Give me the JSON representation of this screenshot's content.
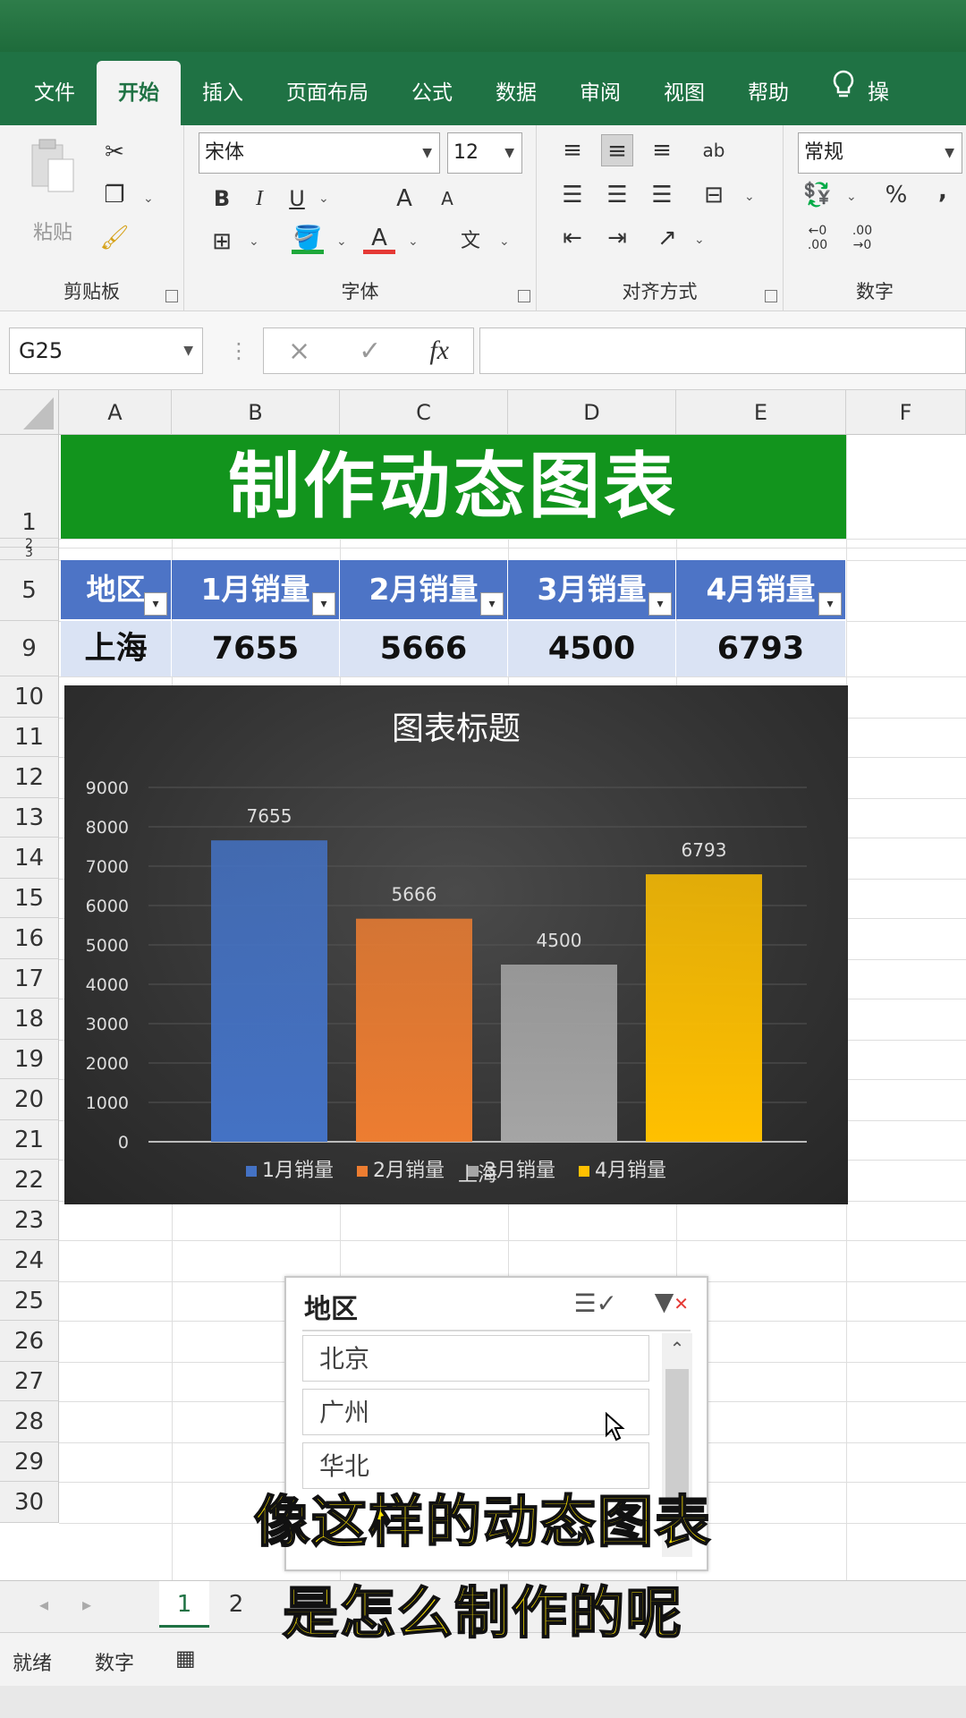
{
  "ribbon_tabs": [
    "文件",
    "开始",
    "插入",
    "页面布局",
    "公式",
    "数据",
    "审阅",
    "视图",
    "帮助"
  ],
  "active_tab": "开始",
  "tell_me": "操",
  "ribbon": {
    "clipboard": {
      "label": "剪贴板",
      "paste": "粘贴"
    },
    "font": {
      "label": "字体",
      "name": "宋体",
      "size": "12",
      "bold": "B",
      "italic": "I",
      "underline": "U",
      "grow": "A",
      "shrink": "A",
      "font_color": "A",
      "phonetic": "文"
    },
    "alignment": {
      "label": "对齐方式",
      "wrap_text": "ab"
    },
    "number": {
      "label": "数字",
      "format": "常规",
      "percent": "%",
      "comma": ","
    }
  },
  "formula_bar": {
    "name_box": "G25",
    "cancel": "×",
    "enter": "✓",
    "fx": "fx",
    "formula": ""
  },
  "columns": [
    "A",
    "B",
    "C",
    "D",
    "E",
    "F"
  ],
  "rows": [
    {
      "n": "1"
    },
    {
      "n": "2"
    },
    {
      "n": "3"
    },
    {
      "n": "5"
    },
    {
      "n": "9"
    },
    {
      "n": "10"
    },
    {
      "n": "11"
    },
    {
      "n": "12"
    },
    {
      "n": "13"
    },
    {
      "n": "14"
    },
    {
      "n": "15"
    },
    {
      "n": "16"
    },
    {
      "n": "17"
    },
    {
      "n": "18"
    },
    {
      "n": "19"
    },
    {
      "n": "20"
    },
    {
      "n": "21"
    },
    {
      "n": "22"
    },
    {
      "n": "23"
    },
    {
      "n": "24"
    },
    {
      "n": "25"
    },
    {
      "n": "26"
    },
    {
      "n": "27"
    },
    {
      "n": "28"
    },
    {
      "n": "29"
    },
    {
      "n": "30"
    }
  ],
  "sheet_title": "制作动态图表",
  "table": {
    "headers": [
      "地区",
      "1月销量",
      "2月销量",
      "3月销量",
      "4月销量"
    ],
    "row": [
      "上海",
      "7655",
      "5666",
      "4500",
      "6793"
    ]
  },
  "chart_data": {
    "type": "bar",
    "title": "图表标题",
    "categories": [
      "上海"
    ],
    "series": [
      {
        "name": "1月销量",
        "values": [
          7655
        ],
        "color": "#4472c4"
      },
      {
        "name": "2月销量",
        "values": [
          5666
        ],
        "color": "#ed7d31"
      },
      {
        "name": "3月销量",
        "values": [
          4500
        ],
        "color": "#a5a5a5"
      },
      {
        "name": "4月销量",
        "values": [
          6793
        ],
        "color": "#ffc000"
      }
    ],
    "ylim": [
      0,
      9000
    ],
    "yticks": [
      "0",
      "1000",
      "2000",
      "3000",
      "4000",
      "5000",
      "6000",
      "7000",
      "8000",
      "9000"
    ],
    "xlabel": "",
    "ylabel": "",
    "grid": true,
    "legend": "bottom",
    "data_labels": true
  },
  "slicer": {
    "title": "地区",
    "items": [
      "北京",
      "广州",
      "华北"
    ]
  },
  "sheet_tabs": [
    "1",
    "2"
  ],
  "active_sheet": "1",
  "status": {
    "ready": "就绪",
    "mode": "数字"
  },
  "subtitles": [
    "像这样的动态图表",
    "是怎么制作的呢"
  ],
  "colors": {
    "excel_green": "#1f7244",
    "title_green": "#12941d",
    "header_blue": "#4d74c6",
    "cell_blue": "#dae3f4",
    "subtitle_yellow": "#ffe500"
  }
}
